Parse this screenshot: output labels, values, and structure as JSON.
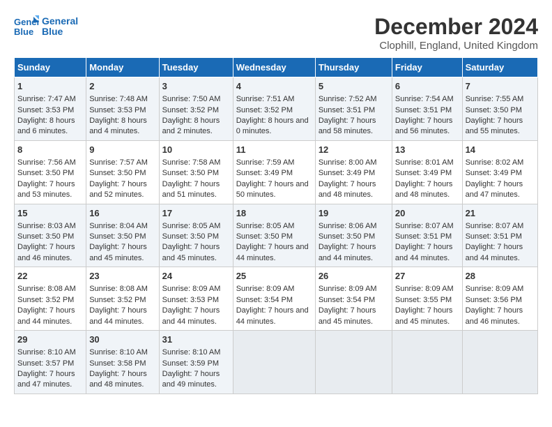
{
  "logo": {
    "line1": "General",
    "line2": "Blue"
  },
  "title": "December 2024",
  "subtitle": "Clophill, England, United Kingdom",
  "header_days": [
    "Sunday",
    "Monday",
    "Tuesday",
    "Wednesday",
    "Thursday",
    "Friday",
    "Saturday"
  ],
  "weeks": [
    [
      {
        "day": "1",
        "sunrise": "7:47 AM",
        "sunset": "3:53 PM",
        "daylight": "8 hours and 6 minutes."
      },
      {
        "day": "2",
        "sunrise": "7:48 AM",
        "sunset": "3:53 PM",
        "daylight": "8 hours and 4 minutes."
      },
      {
        "day": "3",
        "sunrise": "7:50 AM",
        "sunset": "3:52 PM",
        "daylight": "8 hours and 2 minutes."
      },
      {
        "day": "4",
        "sunrise": "7:51 AM",
        "sunset": "3:52 PM",
        "daylight": "8 hours and 0 minutes."
      },
      {
        "day": "5",
        "sunrise": "7:52 AM",
        "sunset": "3:51 PM",
        "daylight": "7 hours and 58 minutes."
      },
      {
        "day": "6",
        "sunrise": "7:54 AM",
        "sunset": "3:51 PM",
        "daylight": "7 hours and 56 minutes."
      },
      {
        "day": "7",
        "sunrise": "7:55 AM",
        "sunset": "3:50 PM",
        "daylight": "7 hours and 55 minutes."
      }
    ],
    [
      {
        "day": "8",
        "sunrise": "7:56 AM",
        "sunset": "3:50 PM",
        "daylight": "7 hours and 53 minutes."
      },
      {
        "day": "9",
        "sunrise": "7:57 AM",
        "sunset": "3:50 PM",
        "daylight": "7 hours and 52 minutes."
      },
      {
        "day": "10",
        "sunrise": "7:58 AM",
        "sunset": "3:50 PM",
        "daylight": "7 hours and 51 minutes."
      },
      {
        "day": "11",
        "sunrise": "7:59 AM",
        "sunset": "3:49 PM",
        "daylight": "7 hours and 50 minutes."
      },
      {
        "day": "12",
        "sunrise": "8:00 AM",
        "sunset": "3:49 PM",
        "daylight": "7 hours and 48 minutes."
      },
      {
        "day": "13",
        "sunrise": "8:01 AM",
        "sunset": "3:49 PM",
        "daylight": "7 hours and 48 minutes."
      },
      {
        "day": "14",
        "sunrise": "8:02 AM",
        "sunset": "3:49 PM",
        "daylight": "7 hours and 47 minutes."
      }
    ],
    [
      {
        "day": "15",
        "sunrise": "8:03 AM",
        "sunset": "3:50 PM",
        "daylight": "7 hours and 46 minutes."
      },
      {
        "day": "16",
        "sunrise": "8:04 AM",
        "sunset": "3:50 PM",
        "daylight": "7 hours and 45 minutes."
      },
      {
        "day": "17",
        "sunrise": "8:05 AM",
        "sunset": "3:50 PM",
        "daylight": "7 hours and 45 minutes."
      },
      {
        "day": "18",
        "sunrise": "8:05 AM",
        "sunset": "3:50 PM",
        "daylight": "7 hours and 44 minutes."
      },
      {
        "day": "19",
        "sunrise": "8:06 AM",
        "sunset": "3:50 PM",
        "daylight": "7 hours and 44 minutes."
      },
      {
        "day": "20",
        "sunrise": "8:07 AM",
        "sunset": "3:51 PM",
        "daylight": "7 hours and 44 minutes."
      },
      {
        "day": "21",
        "sunrise": "8:07 AM",
        "sunset": "3:51 PM",
        "daylight": "7 hours and 44 minutes."
      }
    ],
    [
      {
        "day": "22",
        "sunrise": "8:08 AM",
        "sunset": "3:52 PM",
        "daylight": "7 hours and 44 minutes."
      },
      {
        "day": "23",
        "sunrise": "8:08 AM",
        "sunset": "3:52 PM",
        "daylight": "7 hours and 44 minutes."
      },
      {
        "day": "24",
        "sunrise": "8:09 AM",
        "sunset": "3:53 PM",
        "daylight": "7 hours and 44 minutes."
      },
      {
        "day": "25",
        "sunrise": "8:09 AM",
        "sunset": "3:54 PM",
        "daylight": "7 hours and 44 minutes."
      },
      {
        "day": "26",
        "sunrise": "8:09 AM",
        "sunset": "3:54 PM",
        "daylight": "7 hours and 45 minutes."
      },
      {
        "day": "27",
        "sunrise": "8:09 AM",
        "sunset": "3:55 PM",
        "daylight": "7 hours and 45 minutes."
      },
      {
        "day": "28",
        "sunrise": "8:09 AM",
        "sunset": "3:56 PM",
        "daylight": "7 hours and 46 minutes."
      }
    ],
    [
      {
        "day": "29",
        "sunrise": "8:10 AM",
        "sunset": "3:57 PM",
        "daylight": "7 hours and 47 minutes."
      },
      {
        "day": "30",
        "sunrise": "8:10 AM",
        "sunset": "3:58 PM",
        "daylight": "7 hours and 48 minutes."
      },
      {
        "day": "31",
        "sunrise": "8:10 AM",
        "sunset": "3:59 PM",
        "daylight": "7 hours and 49 minutes."
      },
      null,
      null,
      null,
      null
    ]
  ],
  "colors": {
    "header_bg": "#1a6ab5",
    "odd_row": "#f0f4f8",
    "even_row": "#ffffff",
    "empty_cell": "#e8ecf0"
  },
  "labels": {
    "sunrise_prefix": "Sunrise: ",
    "sunset_prefix": "Sunset: ",
    "daylight_label": "Daylight: "
  }
}
